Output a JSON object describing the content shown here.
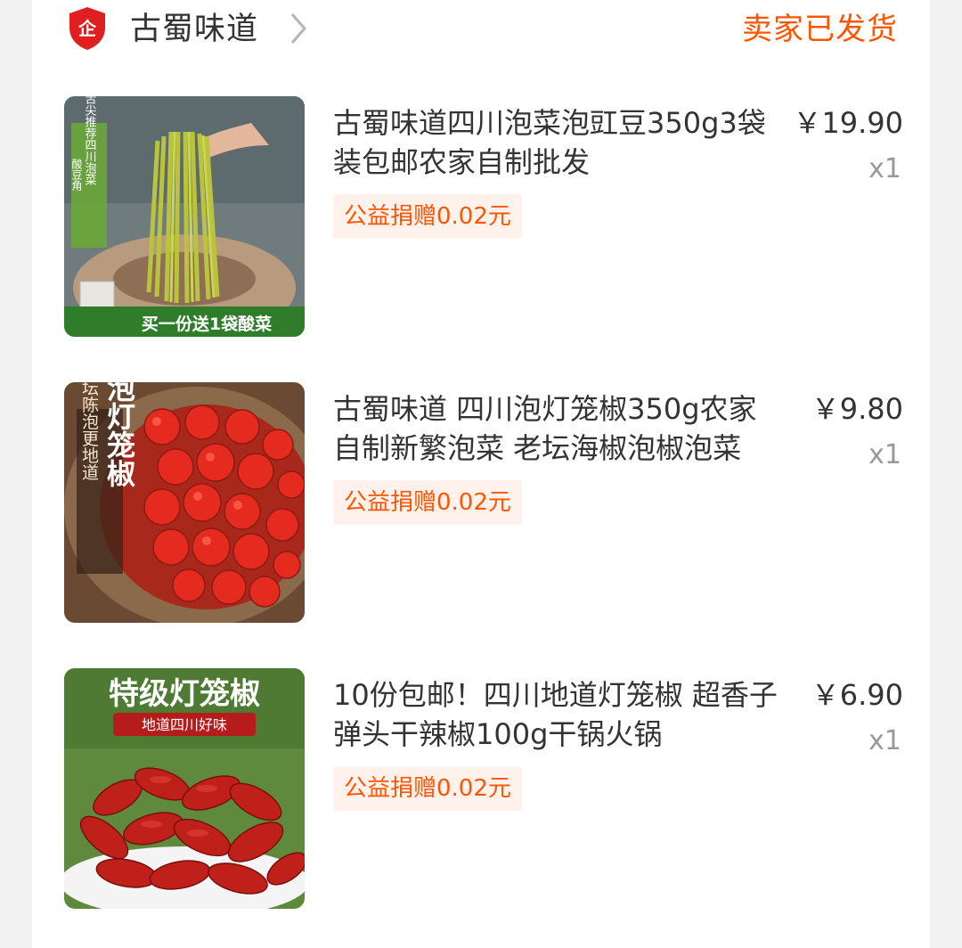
{
  "shop": {
    "logo_text": "企",
    "name": "古蜀味道",
    "status": "卖家已发货",
    "colors": {
      "accent": "#ff5500",
      "logo_red": "#e02020"
    }
  },
  "items": [
    {
      "title": "古蜀味道四川泡菜泡豇豆350g3袋装包邮农家自制批发",
      "price": "￥19.90",
      "qty": "x1",
      "donation": "公益捐赠0.02元",
      "image": {
        "side_text": "舌尖推荐四川泡菜",
        "side_text2": "酸豆角",
        "banner": "买一份送1袋酸菜"
      }
    },
    {
      "title": "古蜀味道 四川泡灯笼椒350g农家自制新繁泡菜 老坛海椒泡椒泡菜",
      "price": "￥9.80",
      "qty": "x1",
      "donation": "公益捐赠0.02元",
      "image": {
        "big_text": "泡灯笼椒",
        "side_text": "老坛陈泡更地道"
      }
    },
    {
      "title": "10份包邮！四川地道灯笼椒 超香子弹头干辣椒100g干锅火锅",
      "price": "￥6.90",
      "qty": "x1",
      "donation": "公益捐赠0.02元",
      "image": {
        "big_text": "特级灯笼椒",
        "sub_text": "地道四川好味"
      }
    }
  ]
}
